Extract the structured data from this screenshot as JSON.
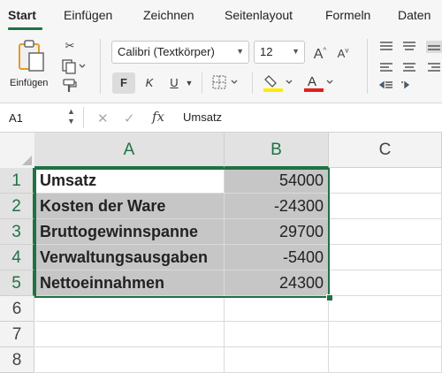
{
  "ribbon_tabs": [
    "Start",
    "Einfügen",
    "Zeichnen",
    "Seitenlayout",
    "Formeln",
    "Daten"
  ],
  "active_tab": "Start",
  "clipboard": {
    "paste_label": "Einfügen"
  },
  "font": {
    "name": "Calibri (Textkörper)",
    "size": "12"
  },
  "format_buttons": {
    "bold": "F",
    "italic": "K",
    "underline": "U"
  },
  "name_box": "A1",
  "formula_bar": {
    "fx": "fx",
    "content": "Umsatz"
  },
  "columns": [
    "A",
    "B",
    "C"
  ],
  "selected_columns": [
    "A",
    "B"
  ],
  "rows": [
    "1",
    "2",
    "3",
    "4",
    "5",
    "6",
    "7",
    "8"
  ],
  "cells": [
    {
      "a": "Umsatz",
      "b": "54000"
    },
    {
      "a": "Kosten der Ware",
      "b": "-24300"
    },
    {
      "a": "Bruttogewinnspanne",
      "b": "29700"
    },
    {
      "a": "Verwaltungsausgaben",
      "b": "-5400"
    },
    {
      "a": "Nettoeinnahmen",
      "b": "24300"
    },
    {
      "a": "",
      "b": ""
    },
    {
      "a": "",
      "b": ""
    },
    {
      "a": "",
      "b": ""
    }
  ],
  "colors": {
    "accent": "#1f7244",
    "selection_fill": "#c6c6c6",
    "highlight_yellow": "#ffeb00",
    "font_red": "#e01f1f"
  },
  "icons": [
    "paste-icon",
    "cut-icon",
    "copy-icon",
    "format-painter-icon",
    "increase-font-icon",
    "decrease-font-icon",
    "borders-icon",
    "highlight-icon",
    "font-color-icon",
    "align-icons"
  ]
}
